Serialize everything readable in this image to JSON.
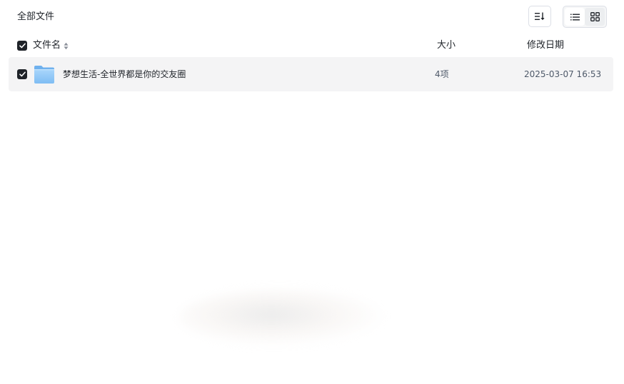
{
  "breadcrumb": {
    "label": "全部文件"
  },
  "toolbar": {
    "sort_icon": "sort-descending-icon",
    "list_view_icon": "list-view-icon",
    "grid_view_icon": "grid-view-icon",
    "active_view": "list"
  },
  "table": {
    "columns": {
      "name": "文件名",
      "size": "大小",
      "modified": "修改日期"
    },
    "header_checked": true,
    "rows": [
      {
        "checked": true,
        "icon": "folder-icon",
        "name": "梦想生活-全世界都是你的交友圈",
        "size": "4项",
        "modified": "2025-03-07 16:53"
      }
    ]
  },
  "colors": {
    "checkbox": "#1f2329",
    "row_highlight": "#f4f4f5",
    "folder": "#8ec5f7"
  }
}
